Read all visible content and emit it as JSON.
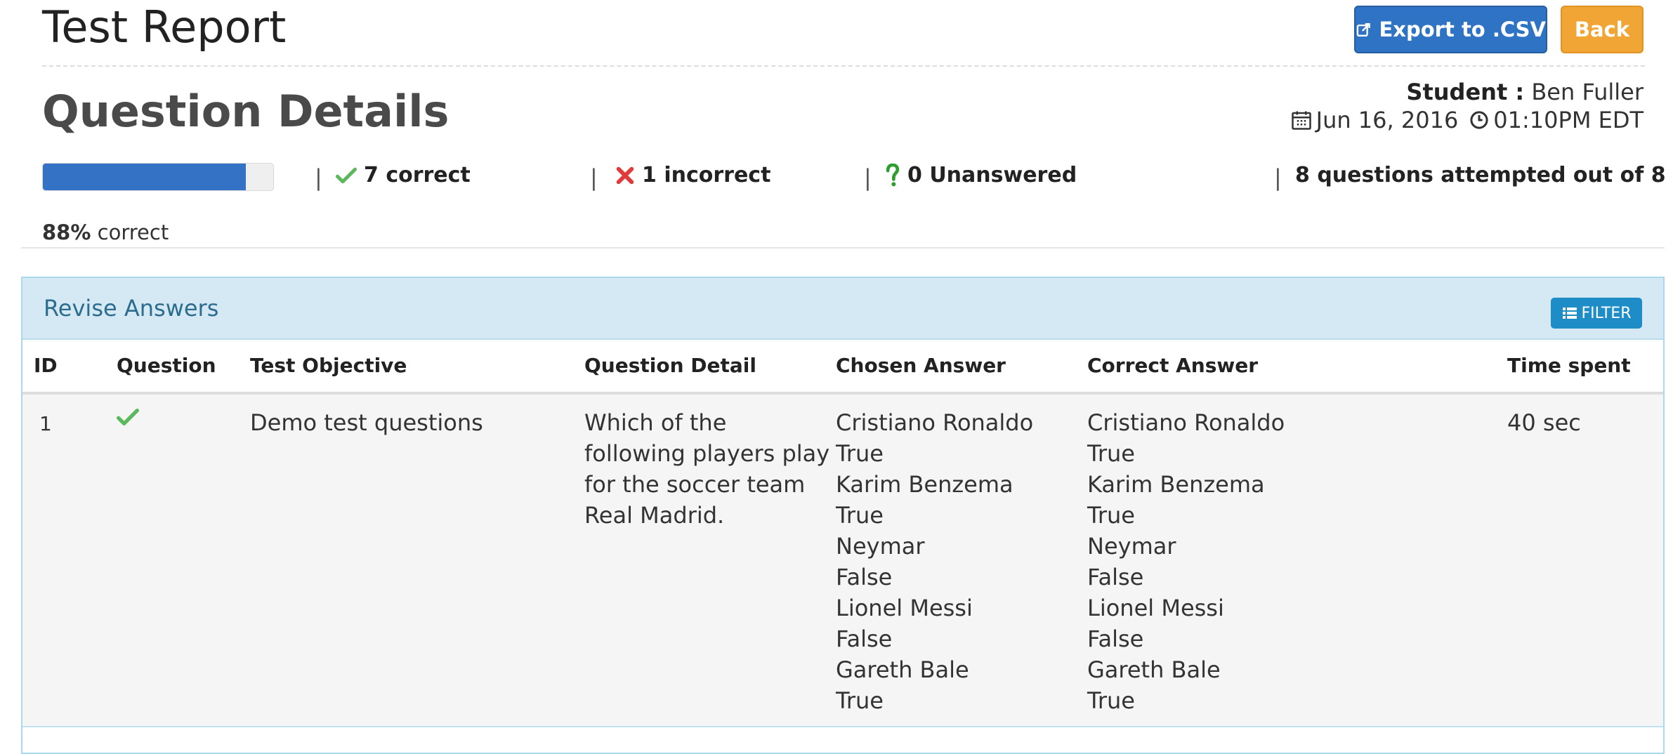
{
  "header": {
    "title": "Test Report",
    "export_label": "Export to .CSV",
    "back_label": "Back"
  },
  "details": {
    "section_title": "Question Details",
    "student_label": "Student :",
    "student_name": "Ben Fuller",
    "date": "Jun 16, 2016",
    "time": "01:10PM EDT"
  },
  "summary": {
    "progress_fraction": 0.88,
    "correct_label": "7 correct",
    "incorrect_label": "1 incorrect",
    "unanswered_label": "0 Unanswered",
    "attempted_label": "8 questions attempted out of 8",
    "percent_value": "88%",
    "percent_suffix": "correct"
  },
  "panel": {
    "title": "Revise Answers",
    "filter_label": "FILTER"
  },
  "table": {
    "columns": [
      "ID",
      "Question",
      "Test Objective",
      "Question Detail",
      "Chosen Answer",
      "Correct Answer",
      "Time spent"
    ],
    "rows": [
      {
        "id": "1",
        "status_icon": "check-icon",
        "objective": "Demo test questions",
        "detail_lines": [
          "Which of the",
          "following players play",
          "for the soccer team",
          "Real Madrid."
        ],
        "chosen_lines": [
          "Cristiano Ronaldo",
          "True",
          "Karim Benzema",
          "True",
          "Neymar",
          "False",
          "Lionel Messi",
          "False",
          "Gareth Bale",
          "True"
        ],
        "correct_lines": [
          "Cristiano Ronaldo",
          "True",
          "Karim Benzema",
          "True",
          "Neymar",
          "False",
          "Lionel Messi",
          "False",
          "Gareth Bale",
          "True"
        ],
        "time_spent": "40 sec"
      }
    ]
  },
  "colors": {
    "primary": "#2f73c4",
    "warning": "#f0a535",
    "info": "#1d8cc7",
    "success": "#5cb85c",
    "danger": "#e03a3a",
    "unanswered": "#2e9e2e"
  }
}
